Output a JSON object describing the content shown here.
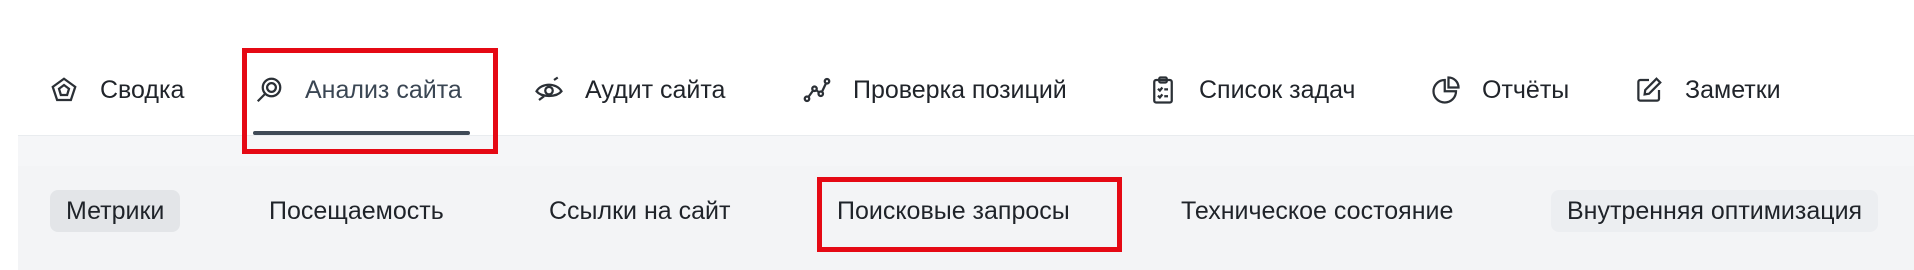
{
  "top_tabs": [
    {
      "label": "Сводка",
      "icon": "pentagon-icon"
    },
    {
      "label": "Анализ сайта",
      "icon": "magnifier-icon"
    },
    {
      "label": "Аудит сайта",
      "icon": "eye-scan-icon"
    },
    {
      "label": "Проверка позиций",
      "icon": "line-graph-icon"
    },
    {
      "label": "Список задач",
      "icon": "clipboard-list-icon"
    },
    {
      "label": "Отчёты",
      "icon": "pie-chart-icon"
    },
    {
      "label": "Заметки",
      "icon": "edit-note-icon"
    }
  ],
  "active_top_tab": "Анализ сайта",
  "sub_tabs": [
    {
      "label": "Метрики"
    },
    {
      "label": "Посещаемость"
    },
    {
      "label": "Ссылки на сайт"
    },
    {
      "label": "Поисковые запросы"
    },
    {
      "label": "Техническое состояние"
    },
    {
      "label": "Внутренняя оптимизация"
    }
  ],
  "active_sub_tab": "Метрики",
  "colors": {
    "highlight": "#e50914",
    "underline": "#3f4a57",
    "subnav_bg": "#f3f4f6"
  }
}
